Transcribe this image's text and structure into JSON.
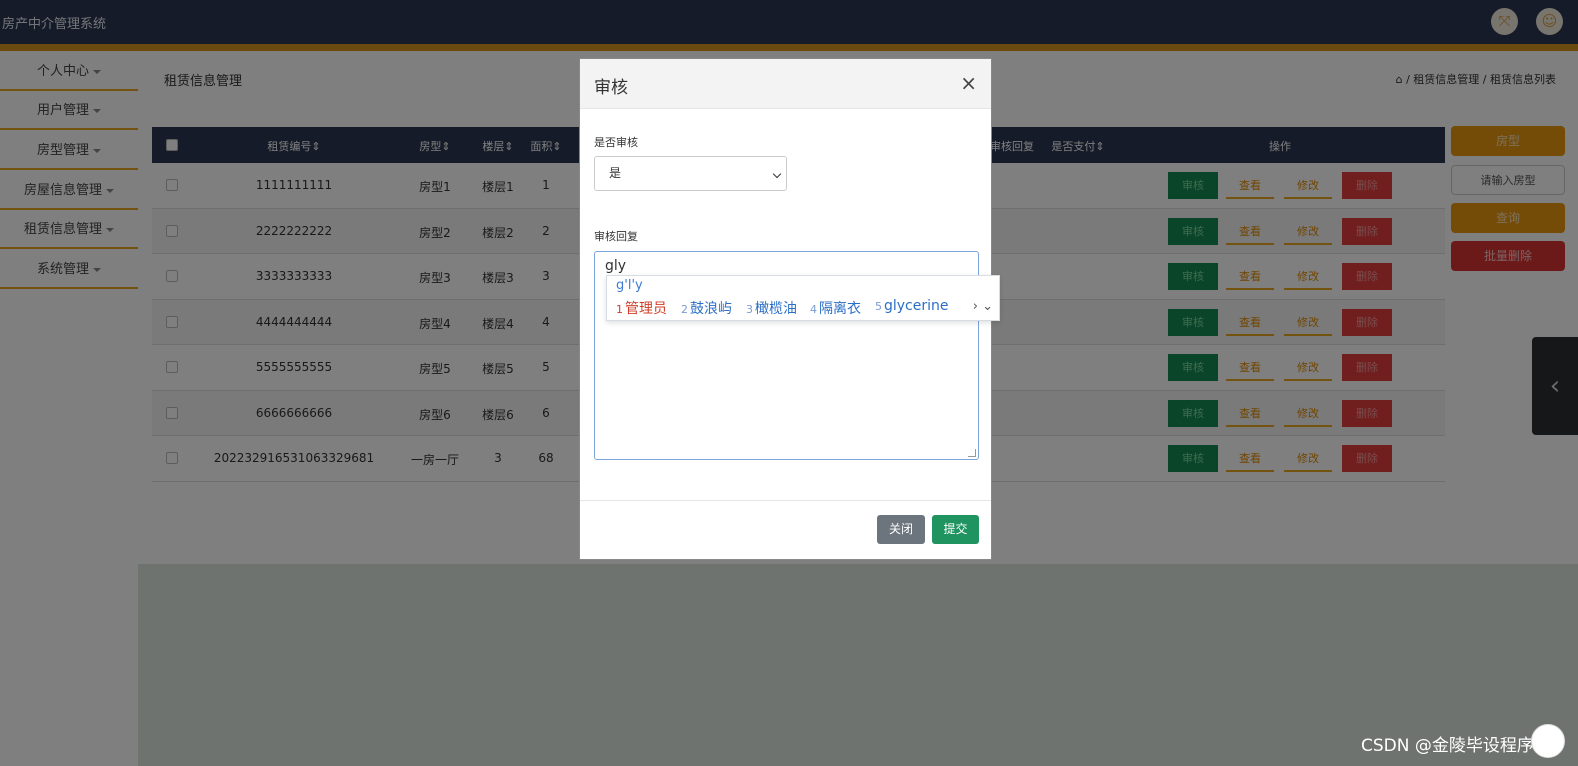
{
  "app": {
    "title": "房产中介管理系统"
  },
  "sidebar": {
    "items": [
      {
        "label": "个人中心"
      },
      {
        "label": "用户管理"
      },
      {
        "label": "房型管理"
      },
      {
        "label": "房屋信息管理"
      },
      {
        "label": "租赁信息管理"
      },
      {
        "label": "系统管理"
      }
    ]
  },
  "page": {
    "title": "租赁信息管理",
    "breadcrumb": "/ 租赁信息管理 / 租赁信息列表"
  },
  "table": {
    "headers": {
      "code": "租赁编号",
      "type": "房型",
      "floor": "楼层",
      "area": "面积",
      "reply": "审核回复",
      "paid": "是否支付",
      "actions": "操作"
    },
    "rows": [
      {
        "code": "1111111111",
        "type": "房型1",
        "floor": "楼层1",
        "area": "1"
      },
      {
        "code": "2222222222",
        "type": "房型2",
        "floor": "楼层2",
        "area": "2"
      },
      {
        "code": "3333333333",
        "type": "房型3",
        "floor": "楼层3",
        "area": "3"
      },
      {
        "code": "4444444444",
        "type": "房型4",
        "floor": "楼层4",
        "area": "4"
      },
      {
        "code": "5555555555",
        "type": "房型5",
        "floor": "楼层5",
        "area": "5"
      },
      {
        "code": "6666666666",
        "type": "房型6",
        "floor": "楼层6",
        "area": "6"
      },
      {
        "code": "202232916531063329681",
        "type": "一房一厅",
        "floor": "3",
        "area": "68"
      }
    ],
    "actions": {
      "audit": "审核",
      "view": "查看",
      "edit": "修改",
      "delete": "删除"
    }
  },
  "search_panel": {
    "label_button": "房型",
    "placeholder": "请输入房型",
    "query_button": "查询",
    "batch_delete_button": "批量删除"
  },
  "modal": {
    "title": "审核",
    "close_symbol": "×",
    "field_status_label": "是否审核",
    "field_status_value": "是",
    "field_reply_label": "审核回复",
    "field_reply_value": "gly",
    "close_button": "关闭",
    "submit_button": "提交"
  },
  "ime": {
    "composition": "g'l'y",
    "candidates": [
      {
        "num": "1",
        "text": "管理员"
      },
      {
        "num": "2",
        "text": "鼓浪屿"
      },
      {
        "num": "3",
        "text": "橄榄油"
      },
      {
        "num": "4",
        "text": "隔离衣"
      },
      {
        "num": "5",
        "text": "glycerine"
      }
    ],
    "nav": "› ⌄"
  },
  "watermark": "CSDN @金陵毕设程序",
  "icons": [
    "fullscreen-icon",
    "user-icon",
    "home-icon",
    "chevron-left-icon",
    "select-arrow-icon"
  ]
}
